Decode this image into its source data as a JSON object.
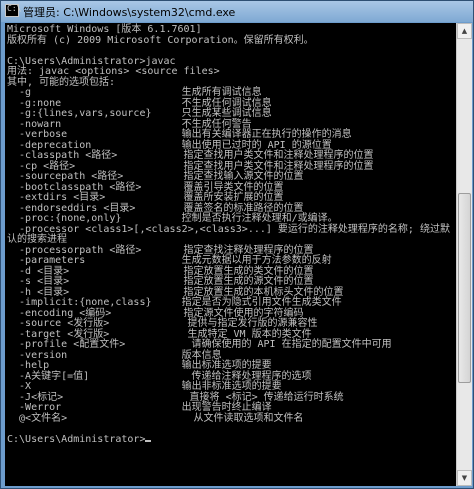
{
  "window": {
    "title": "管理员: C:\\Windows\\system32\\cmd.exe",
    "icon_label": "C:\\"
  },
  "console": {
    "lines": [
      "Microsoft Windows [版本 6.1.7601]",
      "版权所有 (c) 2009 Microsoft Corporation。保留所有权利。",
      "",
      "C:\\Users\\Administrator>javac",
      "用法: javac <options> <source files>",
      "其中, 可能的选项包括:",
      "  -g                         生成所有调试信息",
      "  -g:none                    不生成任何调试信息",
      "  -g:{lines,vars,source}     只生成某些调试信息",
      "  -nowarn                    不生成任何警告",
      "  -verbose                   输出有关编译器正在执行的操作的消息",
      "  -deprecation               输出使用已过时的 API 的源位置",
      "  -classpath <路径>           指定查找用户类文件和注释处理程序的位置",
      "  -cp <路径>                  指定查找用户类文件和注释处理程序的位置",
      "  -sourcepath <路径>          指定查找输入源文件的位置",
      "  -bootclasspath <路径>       覆盖引导类文件的位置",
      "  -extdirs <目录>             覆盖所安装扩展的位置",
      "  -endorseddirs <目录>        覆盖签名的标准路径的位置",
      "  -proc:{none,only}          控制是否执行注释处理和/或编译。",
      "  -processor <class1>[,<class2>,<class3>...] 要运行的注释处理程序的名称; 绕过默",
      "认的搜索进程",
      "  -processorpath <路径>       指定查找注释处理程序的位置",
      "  -parameters                生成元数据以用于方法参数的反射",
      "  -d <目录>                   指定放置生成的类文件的位置",
      "  -s <目录>                   指定放置生成的源文件的位置",
      "  -h <目录>                   指定放置生成的本机标头文件的位置",
      "  -implicit:{none,class}     指定是否为隐式引用文件生成类文件",
      "  -encoding <编码>            指定源文件使用的字符编码",
      "  -source <发行版>             提供与指定发行版的源兼容性",
      "  -target <发行版>             生成特定 VM 版本的类文件",
      "  -profile <配置文件>           请确保使用的 API 在指定的配置文件中可用",
      "  -version                   版本信息",
      "  -help                      输出标准选项的提要",
      "  -A关键字[=值]                 传递给注释处理程序的选项",
      "  -X                         输出非标准选项的提要",
      "  -J<标记>                     直接将 <标记> 传递给运行时系统",
      "  -Werror                    出现警告时终止编译",
      "  @<文件名>                     从文件读取选项和文件名",
      "",
      "C:\\Users\\Administrator>"
    ]
  },
  "scrollbar": {
    "up_arrow": "up-arrow-icon",
    "down_arrow": "down-arrow-icon"
  }
}
